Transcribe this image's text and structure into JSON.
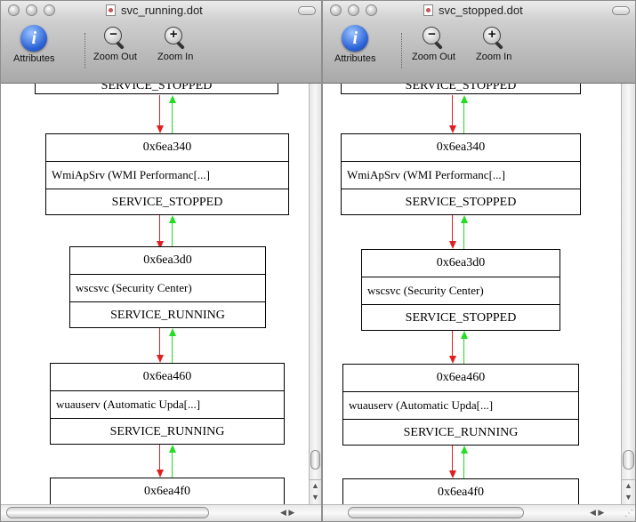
{
  "windows": [
    {
      "title": "svc_running.dot",
      "toolbar": {
        "attributes_label": "Attributes",
        "zoom_out_label": "Zoom Out",
        "zoom_in_label": "Zoom In"
      },
      "graph": {
        "top_partial": "SERVICE_STOPPED",
        "nodes": [
          {
            "address": "0x6ea340",
            "name": "WmiApSrv (WMI Performanc[...]",
            "state": "SERVICE_STOPPED"
          },
          {
            "address": "0x6ea3d0",
            "name": "wscsvc (Security Center)",
            "state": "SERVICE_RUNNING"
          },
          {
            "address": "0x6ea460",
            "name": "wuauserv (Automatic Upda[...]",
            "state": "SERVICE_RUNNING"
          },
          {
            "address": "0x6ea4f0"
          }
        ]
      }
    },
    {
      "title": "svc_stopped.dot",
      "toolbar": {
        "attributes_label": "Attributes",
        "zoom_out_label": "Zoom Out",
        "zoom_in_label": "Zoom In"
      },
      "graph": {
        "top_partial": "SERVICE_STOPPED",
        "nodes": [
          {
            "address": "0x6ea340",
            "name": "WmiApSrv (WMI Performanc[...]",
            "state": "SERVICE_STOPPED"
          },
          {
            "address": "0x6ea3d0",
            "name": "wscsvc (Security Center)",
            "state": "SERVICE_STOPPED"
          },
          {
            "address": "0x6ea460",
            "name": "wuauserv (Automatic Upda[...]",
            "state": "SERVICE_RUNNING"
          },
          {
            "address": "0x6ea4f0"
          }
        ]
      }
    }
  ],
  "icons": {
    "attributes": "info-icon",
    "zoom_out": "zoom-out-icon",
    "zoom_in": "zoom-in-icon",
    "document": "dot-document-icon"
  },
  "colors": {
    "next_edge": "#e02020",
    "prev_edge": "#22dd22",
    "info_blue": "#2a62d6"
  }
}
